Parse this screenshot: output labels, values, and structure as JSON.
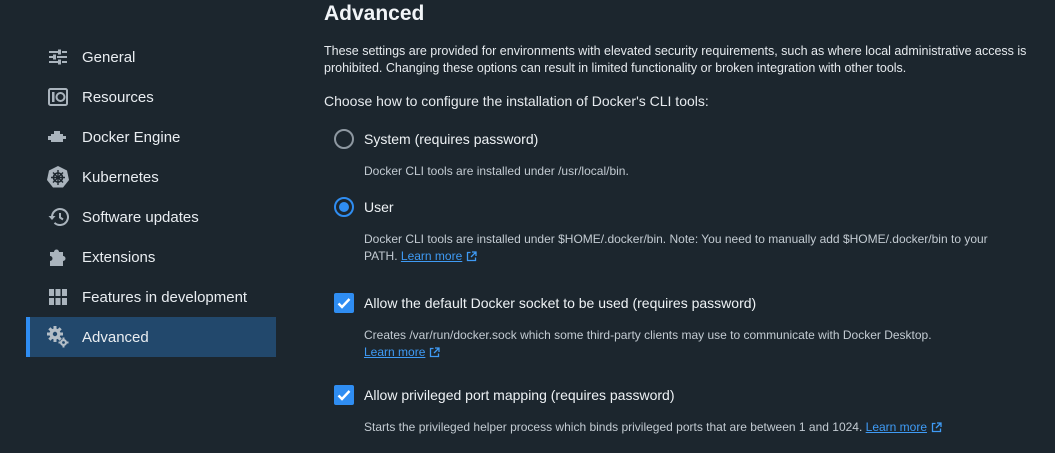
{
  "sidebar": {
    "items": [
      {
        "label": "General",
        "icon": "sliders-icon",
        "active": false
      },
      {
        "label": "Resources",
        "icon": "resources-icon",
        "active": false
      },
      {
        "label": "Docker Engine",
        "icon": "engine-icon",
        "active": false
      },
      {
        "label": "Kubernetes",
        "icon": "kubernetes-icon",
        "active": false
      },
      {
        "label": "Software updates",
        "icon": "history-icon",
        "active": false
      },
      {
        "label": "Extensions",
        "icon": "puzzle-icon",
        "active": false
      },
      {
        "label": "Features in development",
        "icon": "grid-icon",
        "active": false
      },
      {
        "label": "Advanced",
        "icon": "gears-icon",
        "active": true
      }
    ]
  },
  "main": {
    "title": "Advanced",
    "description": "These settings are provided for environments with elevated security requirements, such as where local administrative access is prohibited. Changing these options can result in limited functionality or broken integration with other tools.",
    "question": "Choose how to configure the installation of Docker's CLI tools:",
    "options": {
      "system": {
        "label": "System (requires password)",
        "checked": false,
        "help": "Docker CLI tools are installed under /usr/local/bin."
      },
      "user": {
        "label": "User",
        "checked": true,
        "help": "Docker CLI tools are installed under $HOME/.docker/bin. Note: You need to manually add $HOME/.docker/bin to your PATH.",
        "link": "Learn more"
      },
      "socket": {
        "label": "Allow the default Docker socket to be used (requires password)",
        "checked": true,
        "help": "Creates /var/run/docker.sock which some third-party clients may use to communicate with Docker Desktop.",
        "link": "Learn more"
      },
      "ports": {
        "label": "Allow privileged port mapping (requires password)",
        "checked": true,
        "help": "Starts the privileged helper process which binds privileged ports that are between 1 and 1024.",
        "link": "Learn more"
      }
    }
  },
  "colors": {
    "background": "#1c262e",
    "accent": "#2f8df2",
    "active_nav": "#22486c",
    "link": "#3f9bf5"
  }
}
